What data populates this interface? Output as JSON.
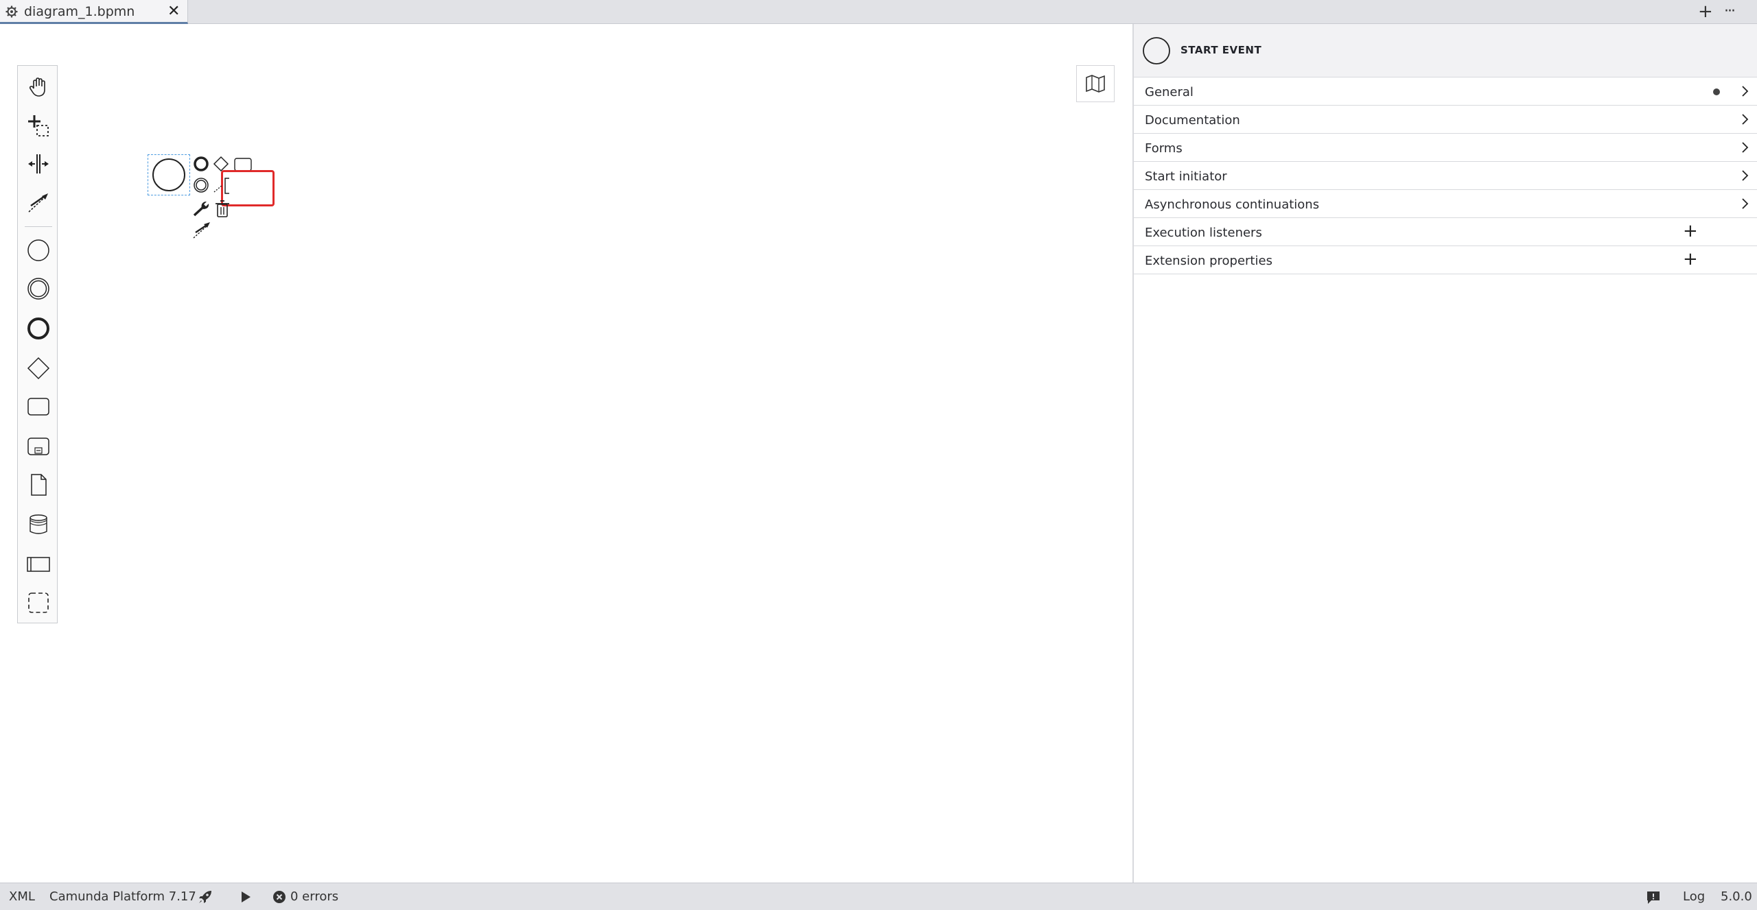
{
  "tab": {
    "title": "diagram_1.bpmn",
    "close_glyph": "✕"
  },
  "tabbar": {
    "add_glyph": "+",
    "more_glyph": "···"
  },
  "palette": {
    "tools": [
      "hand-tool-icon",
      "lasso-tool-icon",
      "space-tool-icon",
      "global-connect-icon",
      "start-event-icon",
      "intermediate-event-icon",
      "end-event-icon",
      "gateway-icon",
      "task-icon",
      "subprocess-icon",
      "data-object-icon",
      "data-store-icon",
      "pool-icon",
      "group-icon"
    ]
  },
  "properties": {
    "header_title": "START EVENT",
    "groups": [
      {
        "label": "General",
        "indicator": "dot"
      },
      {
        "label": "Documentation",
        "indicator": "chevron"
      },
      {
        "label": "Forms",
        "indicator": "chevron"
      },
      {
        "label": "Start initiator",
        "indicator": "chevron"
      },
      {
        "label": "Asynchronous continuations",
        "indicator": "chevron"
      },
      {
        "label": "Execution listeners",
        "indicator": "plus"
      },
      {
        "label": "Extension properties",
        "indicator": "plus"
      }
    ],
    "plus_glyph": "+"
  },
  "status": {
    "xml": "XML",
    "platform": "Camunda Platform 7.17",
    "errors": "0 errors",
    "log": "Log",
    "version": "5.0.0"
  },
  "colors": {
    "highlight": "#e02a2a",
    "selection": "#4c9be0",
    "tab_accent": "#5f7ea6"
  }
}
